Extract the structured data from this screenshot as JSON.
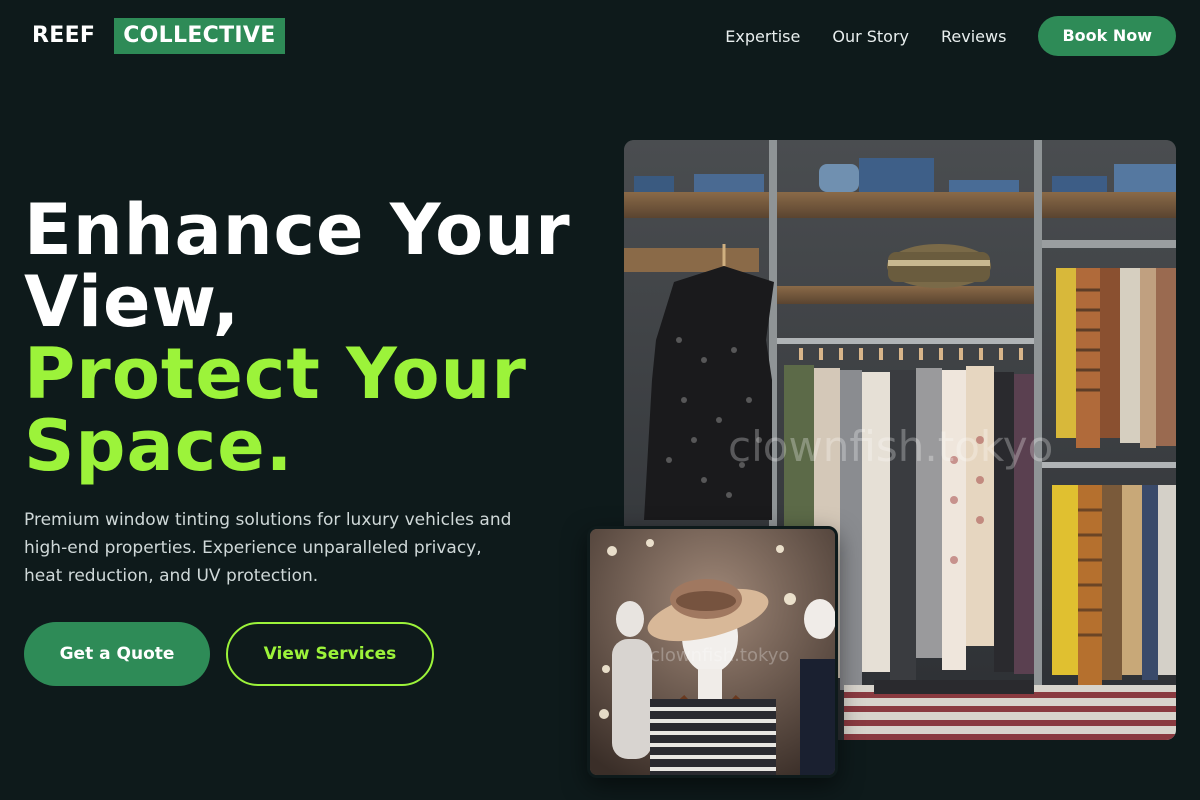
{
  "brand": {
    "part1": "REEF",
    "part2": "COLLECTIVE",
    "accent_color": "#2e8b57",
    "highlight_color": "#9cf33a"
  },
  "nav": {
    "links": [
      "Expertise",
      "Our Story",
      "Reviews"
    ],
    "cta": "Book Now"
  },
  "hero": {
    "title_line1": "Enhance Your",
    "title_line2": "View,",
    "title_line3": "Protect Your",
    "title_line4": "Space.",
    "description": "Premium window tinting solutions for luxury vehicles and high-end properties. Experience unparalleled privacy, heat reduction, and UV protection.",
    "primary_button": "Get a Quote",
    "secondary_button": "View Services"
  },
  "images": {
    "main": {
      "description": "clothing store racks with shelves",
      "watermark": "clownfish.tokyo"
    },
    "secondary": {
      "description": "mannequin wearing hat and striped top",
      "watermark": "clownfish.tokyo"
    }
  }
}
